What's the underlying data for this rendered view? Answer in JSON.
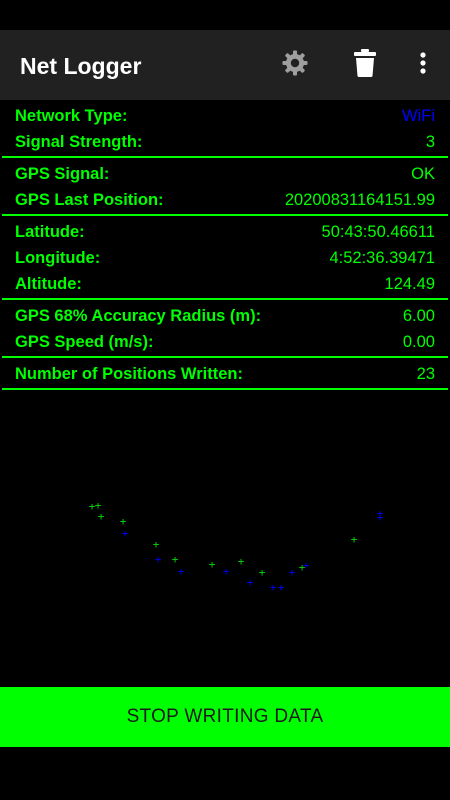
{
  "app": {
    "title": "Net Logger",
    "icons": {
      "settings": "gear-icon",
      "delete": "trash-icon",
      "more": "more-vertical-icon"
    }
  },
  "groups": [
    {
      "rows": [
        {
          "label": "Network Type:",
          "value": "WiFi",
          "value_color": "#0000ff"
        },
        {
          "label": "Signal Strength:",
          "value": "3"
        }
      ]
    },
    {
      "rows": [
        {
          "label": "GPS Signal:",
          "value": "OK"
        },
        {
          "label": "GPS Last Position:",
          "value": "20200831164151.99"
        }
      ]
    },
    {
      "rows": [
        {
          "label": "Latitude:",
          "value": "50:43:50.46611"
        },
        {
          "label": "Longitude:",
          "value": "4:52:36.39471"
        },
        {
          "label": "Altitude:",
          "value": "124.49"
        }
      ]
    },
    {
      "rows": [
        {
          "label": "GPS 68% Accuracy Radius (m):",
          "value": "6.00"
        },
        {
          "label": "GPS Speed (m/s):",
          "value": "0.00"
        }
      ]
    },
    {
      "rows": [
        {
          "label": "Number of Positions Written:",
          "value": "23"
        }
      ]
    }
  ],
  "track_plot": {
    "marker": "+",
    "colors": {
      "green": "#00dd00",
      "blue": "#0000ff"
    }
  },
  "button": {
    "stop_label": "STOP WRITING DATA"
  },
  "colors": {
    "accent": "#00ff00",
    "appbar": "#212121",
    "background": "#000000",
    "network_value": "#0000ff"
  }
}
